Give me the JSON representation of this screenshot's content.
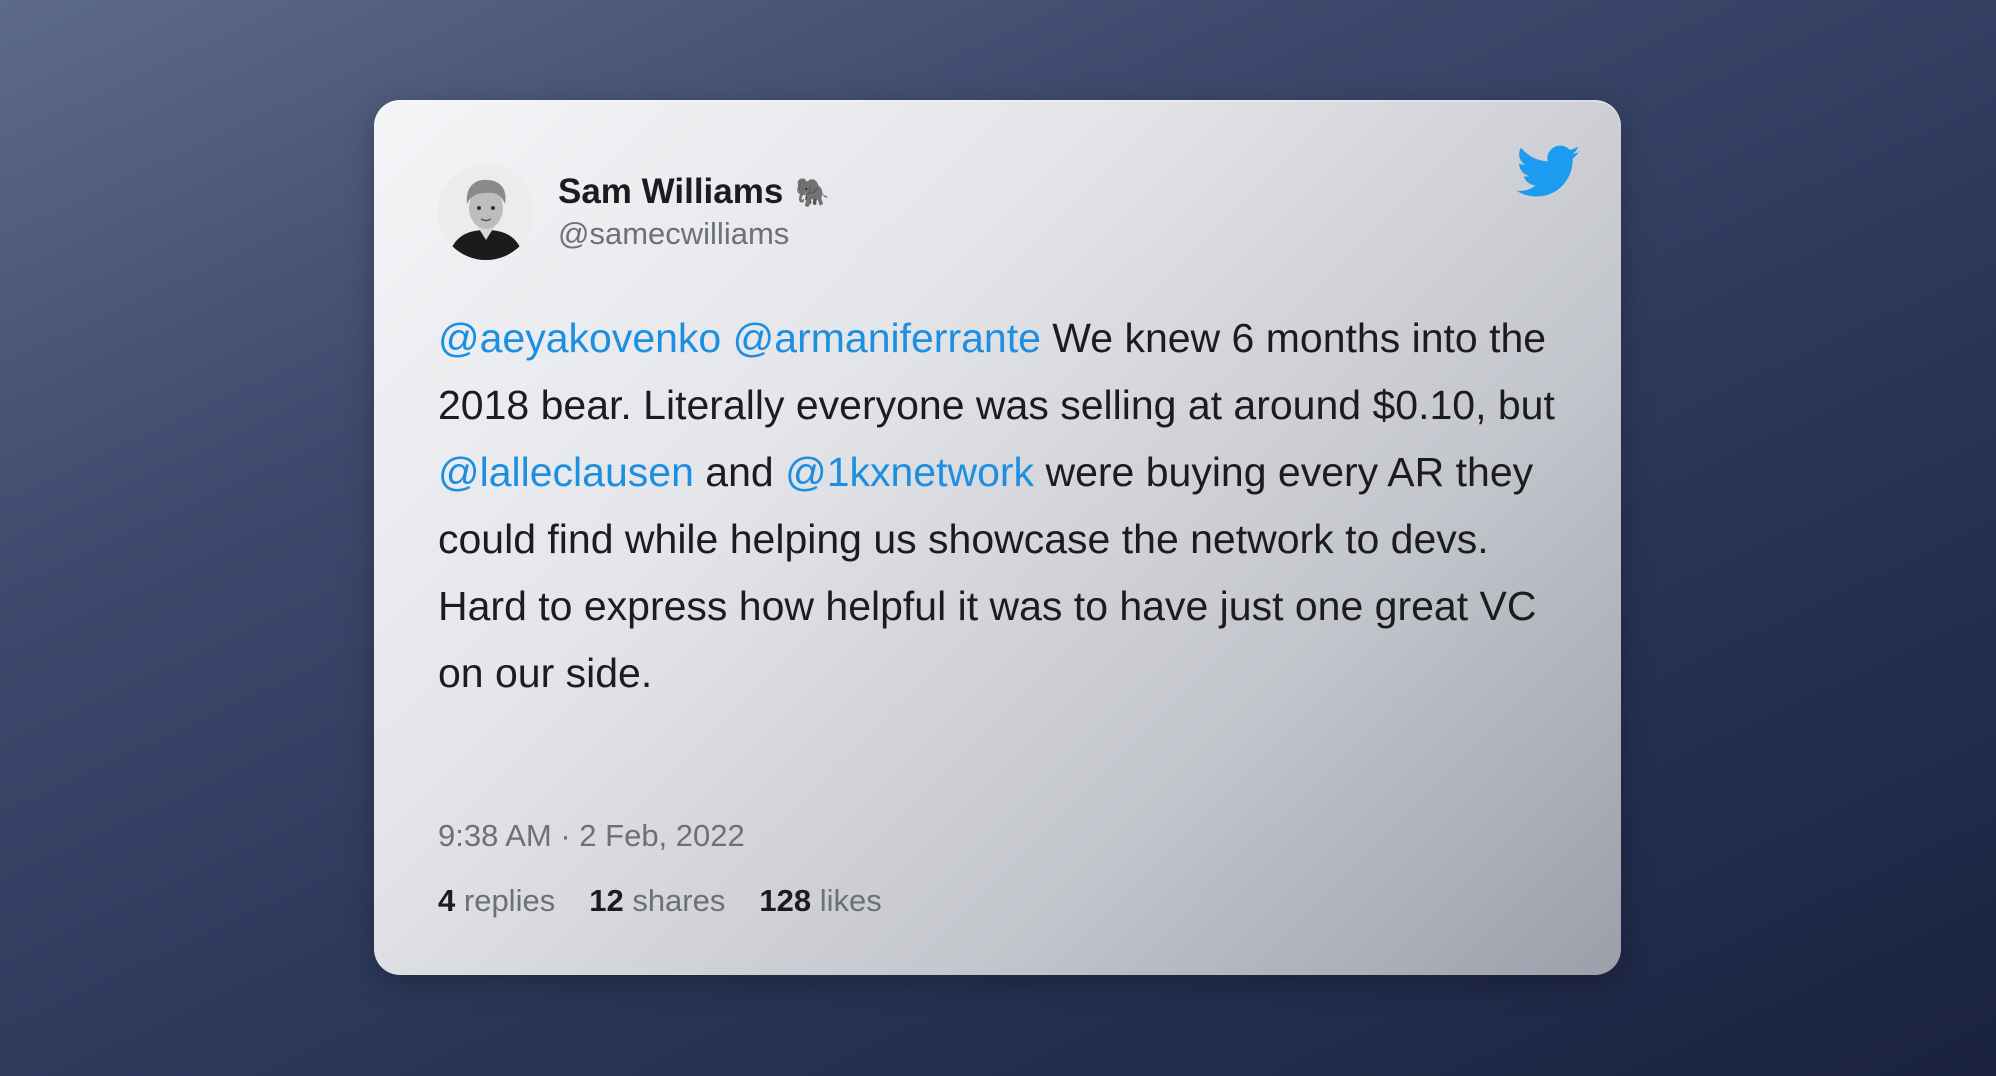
{
  "author": {
    "name": "Sam Williams",
    "emoji": "🐘",
    "handle": "@samecwilliams"
  },
  "tweet": {
    "mention1": "@aeyakovenko",
    "mention2": "@armaniferrante",
    "text1": " We knew 6 months into the 2018 bear. Literally everyone was selling at around $0.10, but ",
    "mention3": "@lalleclausen",
    "text2": " and ",
    "mention4": "@1kxnetwork",
    "text3": " were buying every AR they could find while helping us showcase the network to devs.",
    "text4": "Hard to express how helpful it was to have just one great VC on our side."
  },
  "timestamp": "9:38 AM · 2 Feb, 2022",
  "stats": {
    "replies_count": "4",
    "replies_label": "replies",
    "shares_count": "12",
    "shares_label": "shares",
    "likes_count": "128",
    "likes_label": "likes"
  },
  "colors": {
    "mention": "#1d8fe0",
    "twitter_blue": "#1d9bf0"
  },
  "icons": {
    "brand": "twitter-bird-icon",
    "avatar": "profile-photo"
  }
}
